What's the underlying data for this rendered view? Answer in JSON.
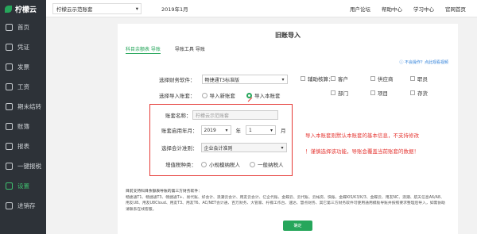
{
  "app": {
    "logo": "柠檬云"
  },
  "sidebar": {
    "items": [
      {
        "label": "首页",
        "icon": "home-icon",
        "active": false
      },
      {
        "label": "凭证",
        "icon": "voucher-icon",
        "active": false
      },
      {
        "label": "发票",
        "icon": "invoice-icon",
        "active": false
      },
      {
        "label": "工资",
        "icon": "salary-icon",
        "active": false
      },
      {
        "label": "期末结转",
        "icon": "closing-icon",
        "active": false
      },
      {
        "label": "账簿",
        "icon": "ledger-icon",
        "active": false
      },
      {
        "label": "报表",
        "icon": "report-icon",
        "active": false
      },
      {
        "label": "一键报税",
        "icon": "tax-icon",
        "active": false
      },
      {
        "label": "设置",
        "icon": "settings-icon",
        "active": true
      },
      {
        "label": "进销存",
        "icon": "inventory-icon",
        "active": false
      }
    ]
  },
  "header": {
    "company": "柠檬云示范账套",
    "period": "2019年1月",
    "links": [
      "用户论坛",
      "帮助中心",
      "学习中心",
      "官网首页"
    ]
  },
  "page": {
    "title": "旧账导入",
    "tabs": [
      "科目余额表 导账",
      "导账工具 导账"
    ],
    "hint": "不会操作？点此观看视频",
    "software_label": "选择财务软件：",
    "software_value": "畅捷通T3标准版",
    "import_label": "选择导入账套：",
    "import_new": "导入新账套",
    "import_current": "导入本账套",
    "aux_label": "辅助核算：",
    "aux_items": [
      "客户",
      "供应商",
      "职员",
      "部门",
      "项目",
      "存货"
    ],
    "account_name_label": "账套名称：",
    "account_name_value": "柠檬云示范账套",
    "start_label": "账套启用年月：",
    "start_year": "2019",
    "year_unit": "年",
    "start_month": "1",
    "month_unit": "月",
    "standard_label": "选择会计准则：",
    "standard_value": "企业会计准则",
    "vat_label": "增值税种类：",
    "vat_small": "小规模纳税人",
    "vat_general": "一般纳税人",
    "red_note_1": "导入本账套则默认本账套的基本信息，不支持修改",
    "red_note_2": "！谨慎选择该功能，导账会覆盖当前账套的数据！",
    "support_head": "目前支持科目余额表导账的第三方财务软件：",
    "support_text": "畅捷通T1、畅捷通T3、畅捷通T+、易代账、好会计、浪潮云会计、用友云会计、亿企代账、金蝶云、云代账、云帐房、快账、金蝶KIS/K3/K/3、金蝶云、用友NC、浪潮、航天信息A6/A8、用友U8、用友U8Cloud、用友T3、用友T6、AC/NET会计通、百万财务、大管家、柠檬工作台、速达、慧点财务、其它第三方财务软件可使用通用模板导账并按照要求整理后导入，如需协助请联系在线客服。",
    "submit_label": "确定"
  }
}
